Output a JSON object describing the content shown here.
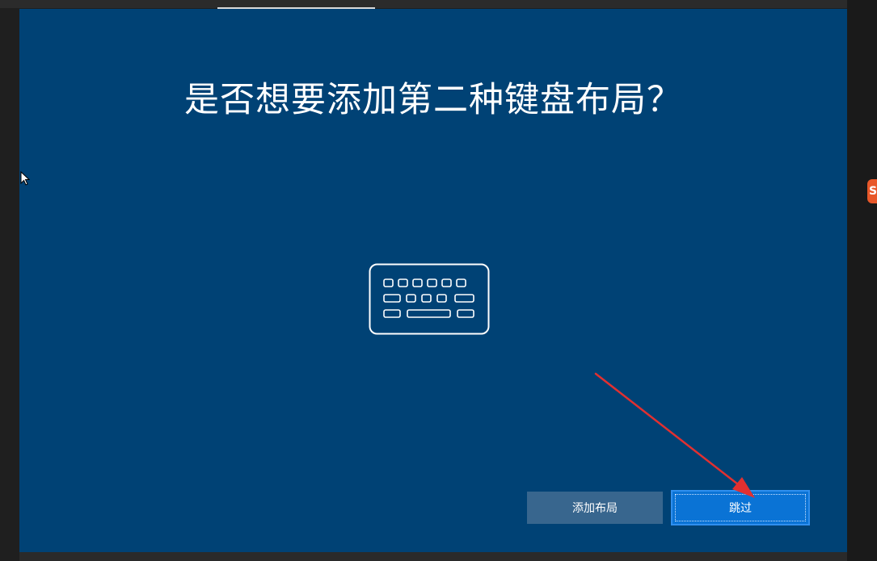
{
  "setup": {
    "title": "是否想要添加第二种键盘布局？",
    "illustration_icon": "keyboard-icon"
  },
  "buttons": {
    "add_layout_label": "添加布局",
    "skip_label": "跳过"
  },
  "side_badge": {
    "glyph": "S",
    "color": "#e8582a"
  },
  "colors": {
    "panel_background": "#004275",
    "primary_button": "#0a73d5",
    "secondary_button": "#38668e",
    "annotation_arrow": "#e23030"
  }
}
